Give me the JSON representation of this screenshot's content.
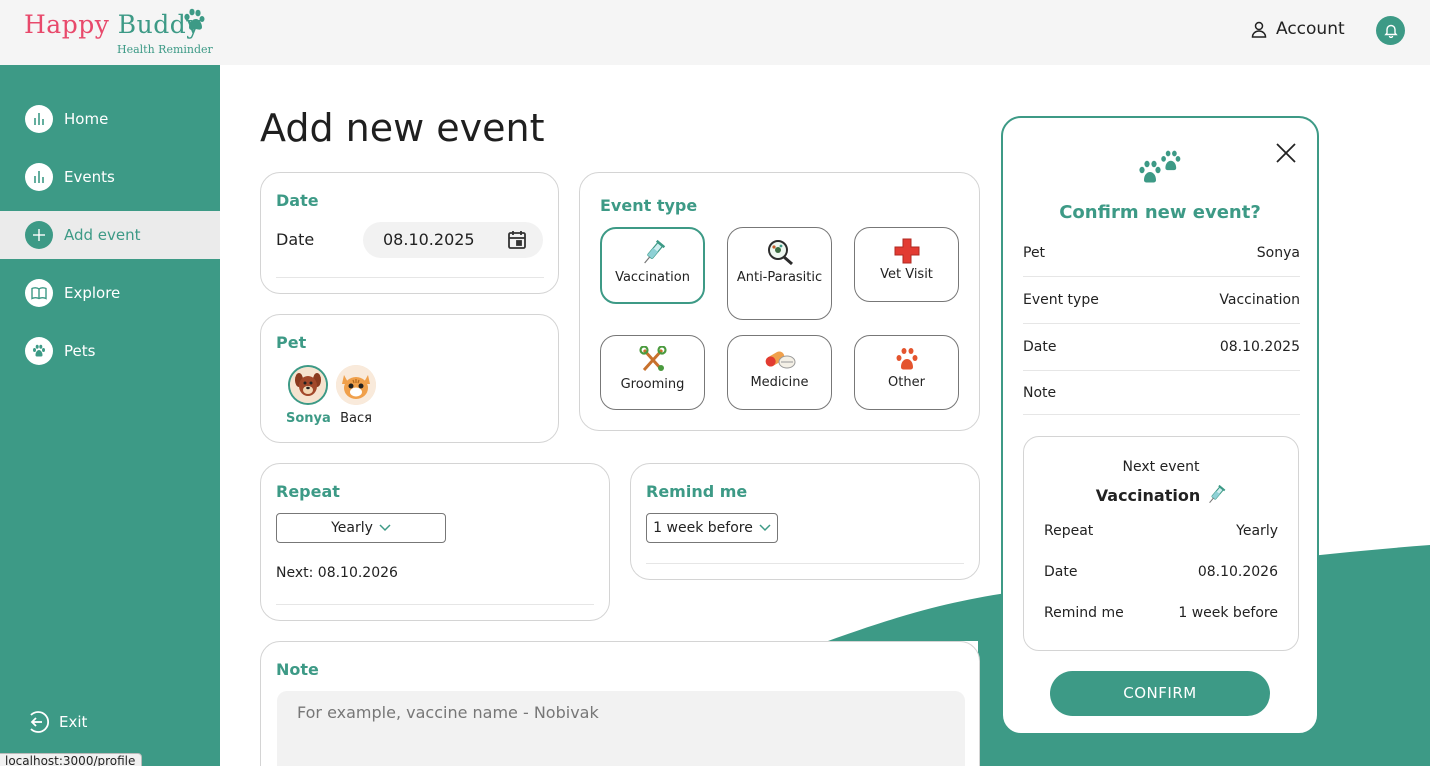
{
  "app": {
    "logo_main_1": "Happy",
    "logo_main_2": "Buddy",
    "logo_sub": "Health Reminder"
  },
  "header": {
    "account_label": "Account"
  },
  "sidebar": {
    "items": [
      {
        "label": "Home",
        "icon": "chart-icon"
      },
      {
        "label": "Events",
        "icon": "chart-icon"
      },
      {
        "label": "Add event",
        "icon": "plus-icon",
        "active": true
      },
      {
        "label": "Explore",
        "icon": "book-icon"
      },
      {
        "label": "Pets",
        "icon": "paw-icon"
      }
    ],
    "exit_label": "Exit"
  },
  "page": {
    "title": "Add new event"
  },
  "date_card": {
    "section": "Date",
    "label": "Date",
    "value": "08.10.2025"
  },
  "pet_card": {
    "section": "Pet",
    "pets": [
      {
        "name": "Sonya",
        "selected": true
      },
      {
        "name": "Вася",
        "selected": false
      }
    ]
  },
  "event_type": {
    "section": "Event type",
    "options": [
      {
        "label": "Vaccination",
        "icon": "syringe-icon",
        "selected": true
      },
      {
        "label": "Anti-Parasitic",
        "icon": "magnifier-bug-icon"
      },
      {
        "label": "Vet Visit",
        "icon": "red-cross-icon"
      },
      {
        "label": "Grooming",
        "icon": "scissors-icon"
      },
      {
        "label": "Medicine",
        "icon": "pill-icon"
      },
      {
        "label": "Other",
        "icon": "paw-icon"
      }
    ]
  },
  "repeat": {
    "section": "Repeat",
    "selected": "Yearly",
    "next_text": "Next: 08.10.2026"
  },
  "remind": {
    "section": "Remind me",
    "selected": "1 week before"
  },
  "note": {
    "section": "Note",
    "placeholder": "For example, vaccine name - Nobivak"
  },
  "modal": {
    "title": "Confirm new event?",
    "rows": [
      {
        "label": "Pet",
        "value": "Sonya"
      },
      {
        "label": "Event type",
        "value": "Vaccination"
      },
      {
        "label": "Date",
        "value": "08.10.2025"
      },
      {
        "label": "Note",
        "value": ""
      }
    ],
    "next": {
      "heading": "Next event",
      "event": "Vaccination",
      "rows": [
        {
          "label": "Repeat",
          "value": "Yearly"
        },
        {
          "label": "Date",
          "value": "08.10.2026"
        },
        {
          "label": "Remind me",
          "value": "1 week before"
        }
      ]
    },
    "confirm_label": "CONFIRM"
  },
  "status_bar": {
    "url": "localhost:3000/profile"
  },
  "colors": {
    "primary": "#3d9a86",
    "brand_pink": "#e8496b",
    "header_bg": "#f5f5f5"
  }
}
